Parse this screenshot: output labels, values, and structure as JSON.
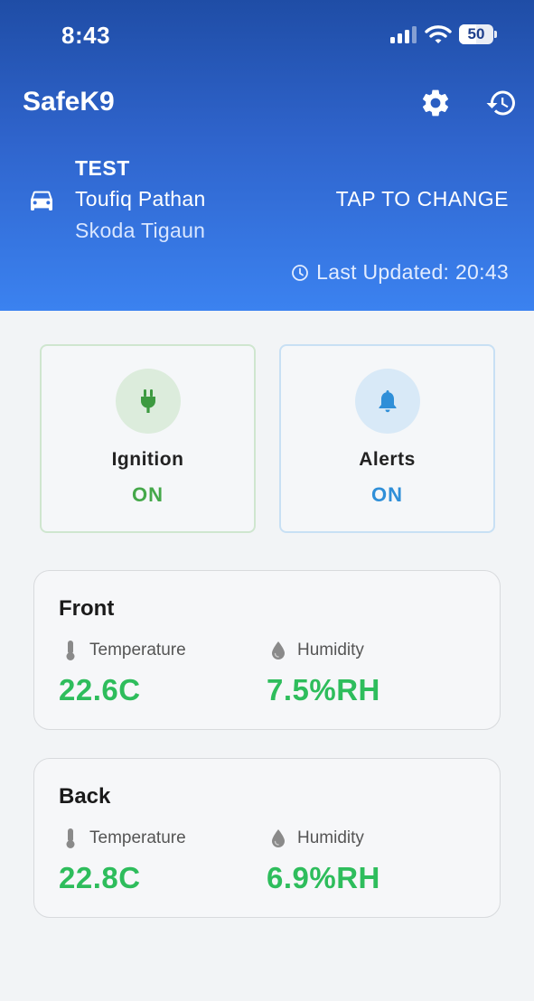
{
  "status_bar": {
    "time": "8:43",
    "battery_percent": "50",
    "battery_level": 0.5,
    "icons": [
      "cellular-signal-icon",
      "wifi-icon",
      "battery-icon"
    ]
  },
  "header": {
    "app_title": "SafeK9",
    "settings_icon": "gear-icon",
    "history_icon": "history-icon",
    "background_gradient": [
      "#1f4da6",
      "#3b82f0"
    ]
  },
  "vehicle": {
    "icon": "car-icon",
    "name": "TEST",
    "driver": "Toufiq Pathan",
    "model": "Skoda Tigaun",
    "change_label": "TAP TO CHANGE",
    "last_updated": "Last Updated: 20:43"
  },
  "status_cards": {
    "ignition": {
      "label": "Ignition",
      "value": "ON",
      "icon": "plug-icon",
      "color": "#45a84a"
    },
    "alerts": {
      "label": "Alerts",
      "value": "ON",
      "icon": "bell-icon",
      "color": "#2f8fd8"
    }
  },
  "sensors": [
    {
      "title": "Front",
      "temperature_label": "Temperature",
      "temperature_value": "22.6C",
      "humidity_label": "Humidity",
      "humidity_value": "7.5%RH"
    },
    {
      "title": "Back",
      "temperature_label": "Temperature",
      "temperature_value": "22.8C",
      "humidity_label": "Humidity",
      "humidity_value": "6.9%RH"
    }
  ],
  "colors": {
    "value_green": "#2ebd5c",
    "page_background": "#f2f4f6"
  }
}
